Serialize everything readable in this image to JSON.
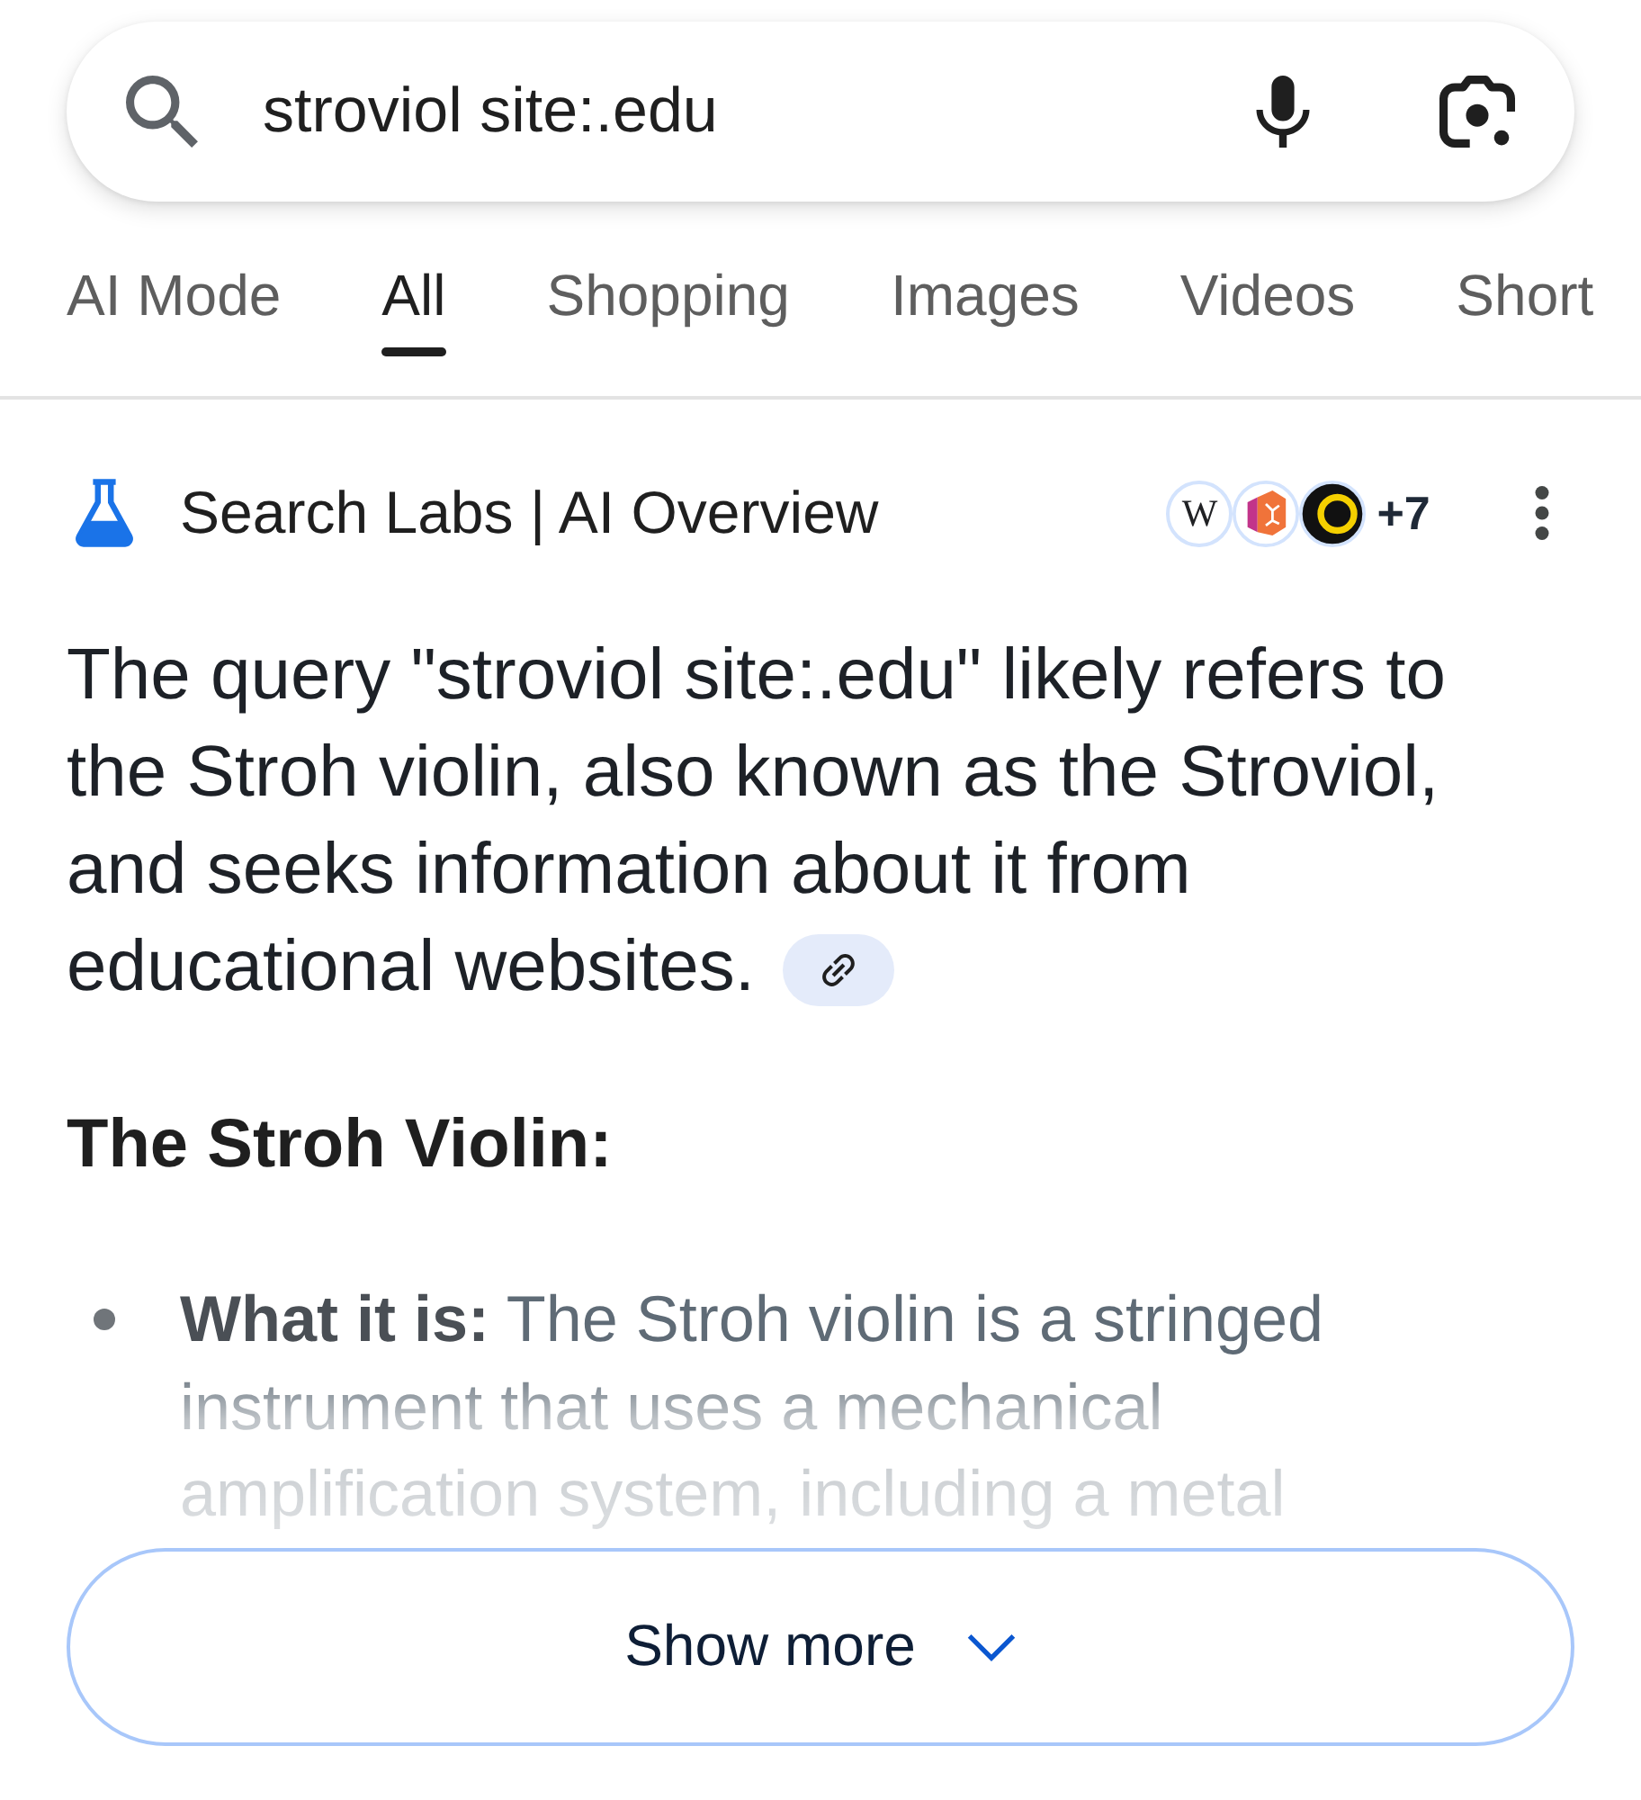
{
  "search": {
    "value": "stroviol site:.edu"
  },
  "tabs": [
    {
      "label": "AI Mode",
      "selected": false
    },
    {
      "label": "All",
      "selected": true
    },
    {
      "label": "Shopping",
      "selected": false
    },
    {
      "label": "Images",
      "selected": false
    },
    {
      "label": "Videos",
      "selected": false
    },
    {
      "label": "Short",
      "selected": false
    }
  ],
  "overview": {
    "title": "Search Labs | AI Overview",
    "sources": [
      {
        "kind": "letter",
        "text": "W"
      },
      {
        "kind": "hexagon"
      },
      {
        "kind": "ring"
      }
    ],
    "more_sources": "+7",
    "summary": "The query \"stroviol site:.edu\" likely refers to the Stroh violin, also known as the Stroviol, and seeks information about it from educational websites.",
    "heading": "The Stroh Violin:",
    "bullets": [
      "**What it is:** The Stroh violin is a stringed instrument that uses a mechanical amplification system, including a metal"
    ],
    "show_more": "Show more"
  }
}
